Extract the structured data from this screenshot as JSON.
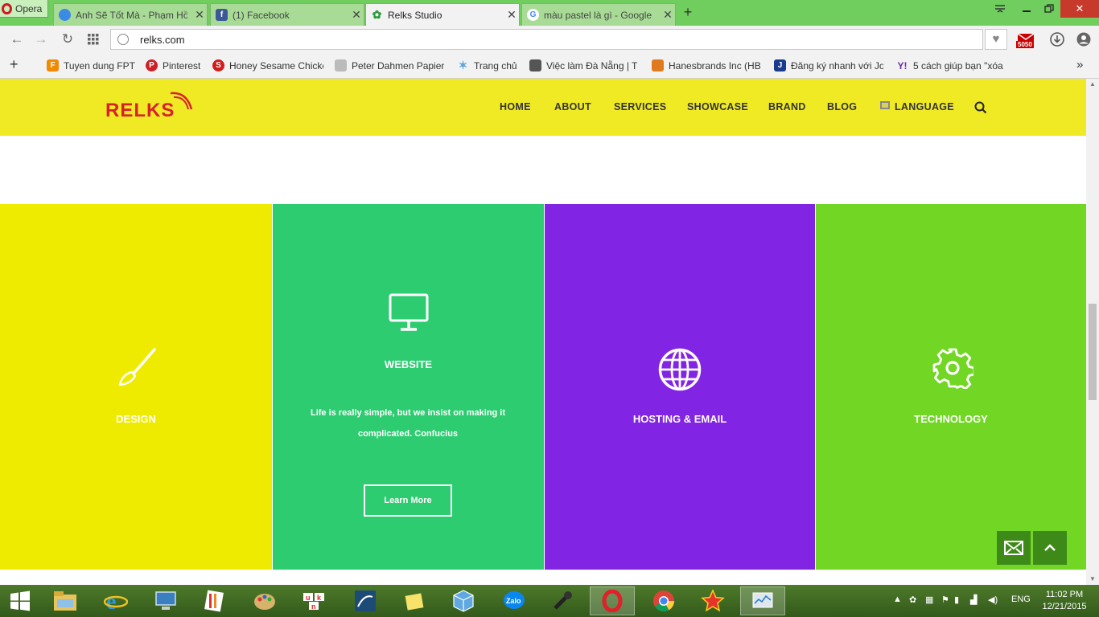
{
  "browser": {
    "menu_label": "Opera",
    "tabs": [
      {
        "title": "Anh Sẽ Tốt Mà - Phạm Hồ",
        "active": false,
        "favicon": "chrome-icon"
      },
      {
        "title": "(1) Facebook",
        "active": false,
        "favicon": "facebook-icon"
      },
      {
        "title": "Relks Studio",
        "active": true,
        "favicon": "relks-icon"
      },
      {
        "title": "màu pastel là gì - Google",
        "active": false,
        "favicon": "google-icon"
      }
    ],
    "url": "relks.com",
    "bookmarks": [
      {
        "label": "Tuyen dung FPT",
        "icon": "fpt-icon"
      },
      {
        "label": "Pinterest",
        "icon": "pinterest-icon"
      },
      {
        "label": "Honey Sesame Chicke",
        "icon": "recipe-icon"
      },
      {
        "label": "Peter Dahmen Papier",
        "icon": "paper-icon"
      },
      {
        "label": "Trang chủ",
        "icon": "star-icon"
      },
      {
        "label": "Việc làm Đà Nẵng | T",
        "icon": "jobs-icon"
      },
      {
        "label": "Hanesbrands Inc (HB",
        "icon": "hanes-icon"
      },
      {
        "label": "Đăng ký nhanh với Jo",
        "icon": "jobstreet-icon"
      },
      {
        "label": "5 cách giúp bạn \"xóa",
        "icon": "yahoo-icon"
      }
    ],
    "ext_badge": "5050"
  },
  "site": {
    "logo": "RELKS",
    "nav": [
      "HOME",
      "ABOUT",
      "SERVICES",
      "SHOWCASE",
      "BRAND",
      "BLOG",
      "LANGUAGE"
    ],
    "services": [
      {
        "title": "DESIGN",
        "color": "#efeb00",
        "icon": "paintbrush-icon"
      },
      {
        "title": "WEBSITE",
        "color": "#2ecc71",
        "icon": "monitor-icon",
        "description": "Life is really simple, but we insist on making it complicated. Confucius",
        "button": "Learn More"
      },
      {
        "title": "HOSTING & EMAIL",
        "color": "#8224e3",
        "icon": "globe-icon"
      },
      {
        "title": "TECHNOLOGY",
        "color": "#72d625",
        "icon": "gear-icon"
      }
    ]
  },
  "taskbar": {
    "language": "ENG",
    "time": "11:02 PM",
    "date": "12/21/2015"
  }
}
